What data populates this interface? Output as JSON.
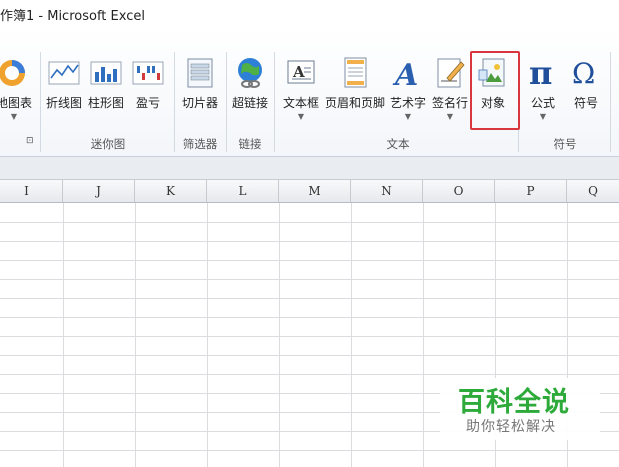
{
  "window": {
    "title": "作簿1 - Microsoft Excel"
  },
  "ribbon": {
    "buttons": {
      "map_chart": "地图表",
      "line_spark": "折线图",
      "column_spark": "柱形图",
      "winloss_spark": "盈亏",
      "slicer": "切片器",
      "hyperlink": "超链接",
      "textbox": "文本框",
      "header_footer": "页眉和页脚",
      "wordart": "艺术字",
      "signature": "签名行",
      "object": "对象",
      "equation": "公式",
      "symbol": "符号"
    },
    "groups": {
      "sparklines": "迷你图",
      "filter": "筛选器",
      "links": "链接",
      "text": "文本",
      "symbols": "符号"
    },
    "colors": {
      "highlight": "#d9363e",
      "accent": "#1f4e9a"
    }
  },
  "columns": [
    "I",
    "J",
    "K",
    "L",
    "M",
    "N",
    "O",
    "P",
    "Q"
  ],
  "watermark": {
    "title": "百科全说",
    "subtitle": "助你轻松解决"
  }
}
